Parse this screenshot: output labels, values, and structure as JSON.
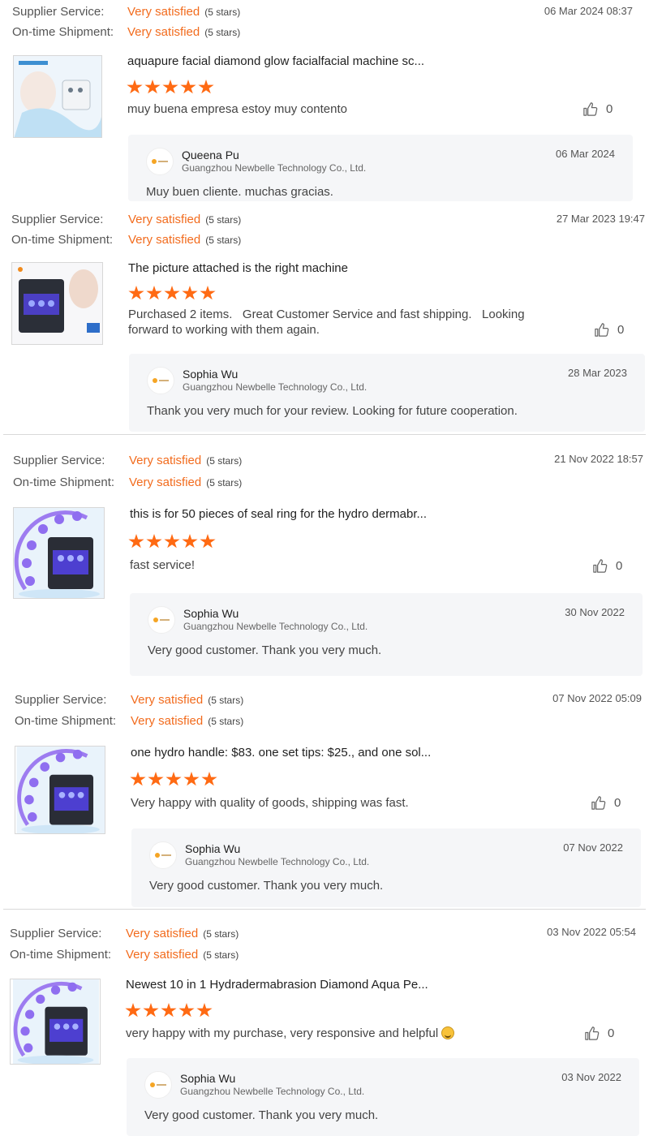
{
  "labels": {
    "supplier_service": "Supplier Service:",
    "ontime_shipment": "On-time Shipment:",
    "very_satisfied": "Very satisfied",
    "five_stars": "(5 stars)"
  },
  "colors": {
    "accent": "#f26b1d",
    "star": "#ff6a13",
    "reply_bg": "#f5f6f8"
  },
  "reviews": [
    {
      "date": "06 Mar 2024 08:37",
      "product_title": "aquapure facial diamond glow facialfacial machine sc...",
      "rating": 5,
      "comment": "muy buena empresa estoy muy contento",
      "likes": "0",
      "reply": {
        "name": "Queena Pu",
        "company": "Guangzhou Newbelle Technology Co., Ltd.",
        "date": "06 Mar 2024",
        "text": "Muy buen cliente. muchas gracias."
      }
    },
    {
      "date": "27 Mar 2023 19:47",
      "product_title": "The picture attached is the right machine",
      "rating": 5,
      "comment_line1": "Purchased 2 items.   Great Customer Service and fast shipping.   Looking",
      "comment_line2": "forward to working with them again.",
      "likes": "0",
      "reply": {
        "name": "Sophia Wu",
        "company": "Guangzhou Newbelle Technology Co., Ltd.",
        "date": "28 Mar 2023",
        "text": "Thank you very much for your review. Looking for future cooperation."
      }
    },
    {
      "date": "21 Nov 2022 18:57",
      "product_title": "this is for 50 pieces of seal ring for the hydro dermabr...",
      "rating": 5,
      "comment": "fast service!",
      "likes": "0",
      "reply": {
        "name": "Sophia Wu",
        "company": "Guangzhou Newbelle Technology Co., Ltd.",
        "date": "30 Nov 2022",
        "text": "Very good customer. Thank you very much."
      }
    },
    {
      "date": "07 Nov 2022 05:09",
      "product_title": "one hydro handle: $83. one set tips: $25., and one sol...",
      "rating": 5,
      "comment": "Very happy with quality of goods, shipping was fast.",
      "likes": "0",
      "reply": {
        "name": "Sophia Wu",
        "company": "Guangzhou Newbelle Technology Co., Ltd.",
        "date": "07 Nov 2022",
        "text": "Very good customer. Thank you very much."
      }
    },
    {
      "date": "03 Nov 2022 05:54",
      "product_title": "Newest 10 in 1 Hydradermabrasion Diamond Aqua Pe...",
      "rating": 5,
      "comment": "very happy with my purchase, very responsive and helpful",
      "emoji": "smiling-face-icon",
      "likes": "0",
      "reply": {
        "name": "Sophia Wu",
        "company": "Guangzhou Newbelle Technology Co., Ltd.",
        "date": "03 Nov 2022",
        "text": "Very good customer. Thank you very much."
      }
    }
  ]
}
